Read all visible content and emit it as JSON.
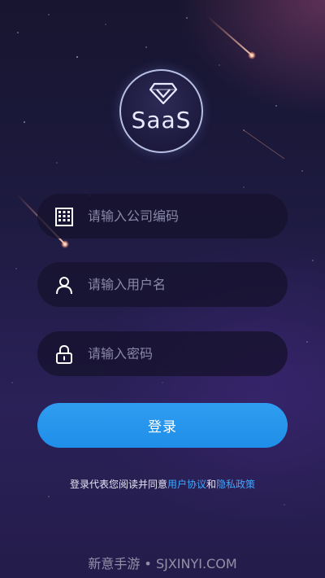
{
  "logo": {
    "text": "SaaS",
    "icon": "diamond-icon"
  },
  "form": {
    "company": {
      "placeholder": "请输入公司编码",
      "icon": "building-icon"
    },
    "username": {
      "placeholder": "请输入用户名",
      "icon": "user-icon"
    },
    "password": {
      "placeholder": "请输入密码",
      "icon": "lock-icon"
    }
  },
  "login_button": {
    "label": "登录"
  },
  "agreement": {
    "prefix": "登录代表您阅读并同意",
    "user_agreement": "用户协议",
    "and": "和",
    "privacy_policy": "隐私政策"
  },
  "watermark": "新意手游 • SJXINYI.COM",
  "colors": {
    "accent": "#2196ee",
    "link": "#3ea8ff",
    "background": "#221b45"
  }
}
